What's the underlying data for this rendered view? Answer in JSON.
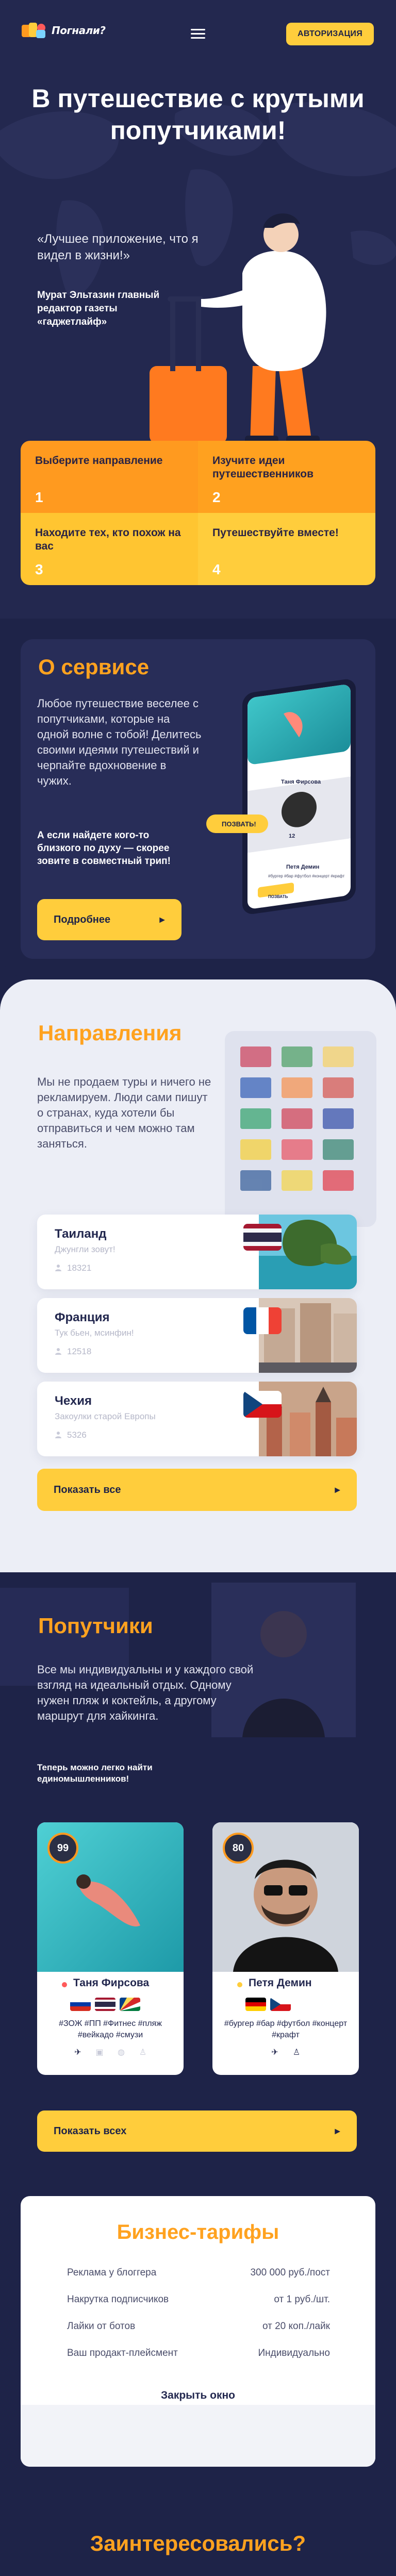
{
  "header": {
    "logo_text": "Погнали?",
    "auth_label": "АВТОРИЗАЦИЯ"
  },
  "hero": {
    "title": "В путешествие с крутыми попутчиками!",
    "quote": "«Лучшее приложение, что я видел в жизни!»",
    "author": "Мурат Эльтазин главный редактор газеты «гаджетлайф»",
    "steps": [
      {
        "label": "Выберите направление",
        "num": "1"
      },
      {
        "label": "Изучите идеи путешественников",
        "num": "2"
      },
      {
        "label": "Находите тех, кто похож на вас",
        "num": "3"
      },
      {
        "label": "Путешествуйте вместе!",
        "num": "4"
      }
    ]
  },
  "about": {
    "title": "О сервисе",
    "text": "Любое путешествие веселее с попутчиками, которые на одной волне с тобой! Делитесь своими идеями путешествий и черпайте вдохновение в чужих.",
    "call": "А если найдете кого-то близкого по духу — скорее зовите в совместный трип!",
    "button": "Подробнее",
    "phone": {
      "invite_label": "ПОЗВАТЬ!",
      "card1_name": "Таня Фирсова",
      "card2_name": "Петя Демин",
      "card2_tags": "#бургер #бар #футбол #концерт #крафт",
      "card2_btn": "ПОЗВАТЬ",
      "like_count": "12"
    }
  },
  "directions": {
    "title": "Направления",
    "text": "Мы не продаем туры и ничего не рекламируем. Люди сами пишут о странах, куда хотели бы отправиться и чем можно там заняться.",
    "countries": [
      {
        "name": "Таиланд",
        "sub": "Джунгли зовут!",
        "count": "18321"
      },
      {
        "name": "Франция",
        "sub": "Тук бьен, мсинфин!",
        "count": "12518"
      },
      {
        "name": "Чехия",
        "sub": "Закоулки старой Европы",
        "count": "5326"
      }
    ],
    "button": "Показать все"
  },
  "companions": {
    "title": "Попутчики",
    "text": "Все мы индивидуальны и у каждого свой взгляд на идеальный отдых. Одному нужен пляж и коктейль, а другому маршрут для хайкинга.",
    "call": "Теперь можно легко найти единомышленников!",
    "people": [
      {
        "name": "Таня Фирсова",
        "score": "99",
        "tags": "#ЗОЖ #ПП #Фитнес #пляж #вейкадо #смузи",
        "status_color": "#ff5a5a"
      },
      {
        "name": "Петя Демин",
        "score": "80",
        "tags": "#бургер #бар #футбол #концерт #крафт",
        "status_color": "#ffcd3c"
      }
    ],
    "button": "Показать всех"
  },
  "tariffs": {
    "title": "Бизнес-тарифы",
    "rows": [
      {
        "label": "Реклама у блоггера",
        "price": "300 000 руб./пост"
      },
      {
        "label": "Накрутка подписчиков",
        "price": "от 1 руб./шт."
      },
      {
        "label": "Лайки от ботов",
        "price": "от 20 коп./лайк"
      },
      {
        "label": "Ваш продакт-плейсмент",
        "price": "Индивидуально"
      }
    ],
    "close": "Закрыть окно"
  },
  "footer": {
    "interested": "Заинтересовались?"
  },
  "colors": {
    "navy": "#1e2348",
    "orange": "#ffa21f",
    "yellow": "#ffcd3c",
    "light": "#eceef6"
  }
}
